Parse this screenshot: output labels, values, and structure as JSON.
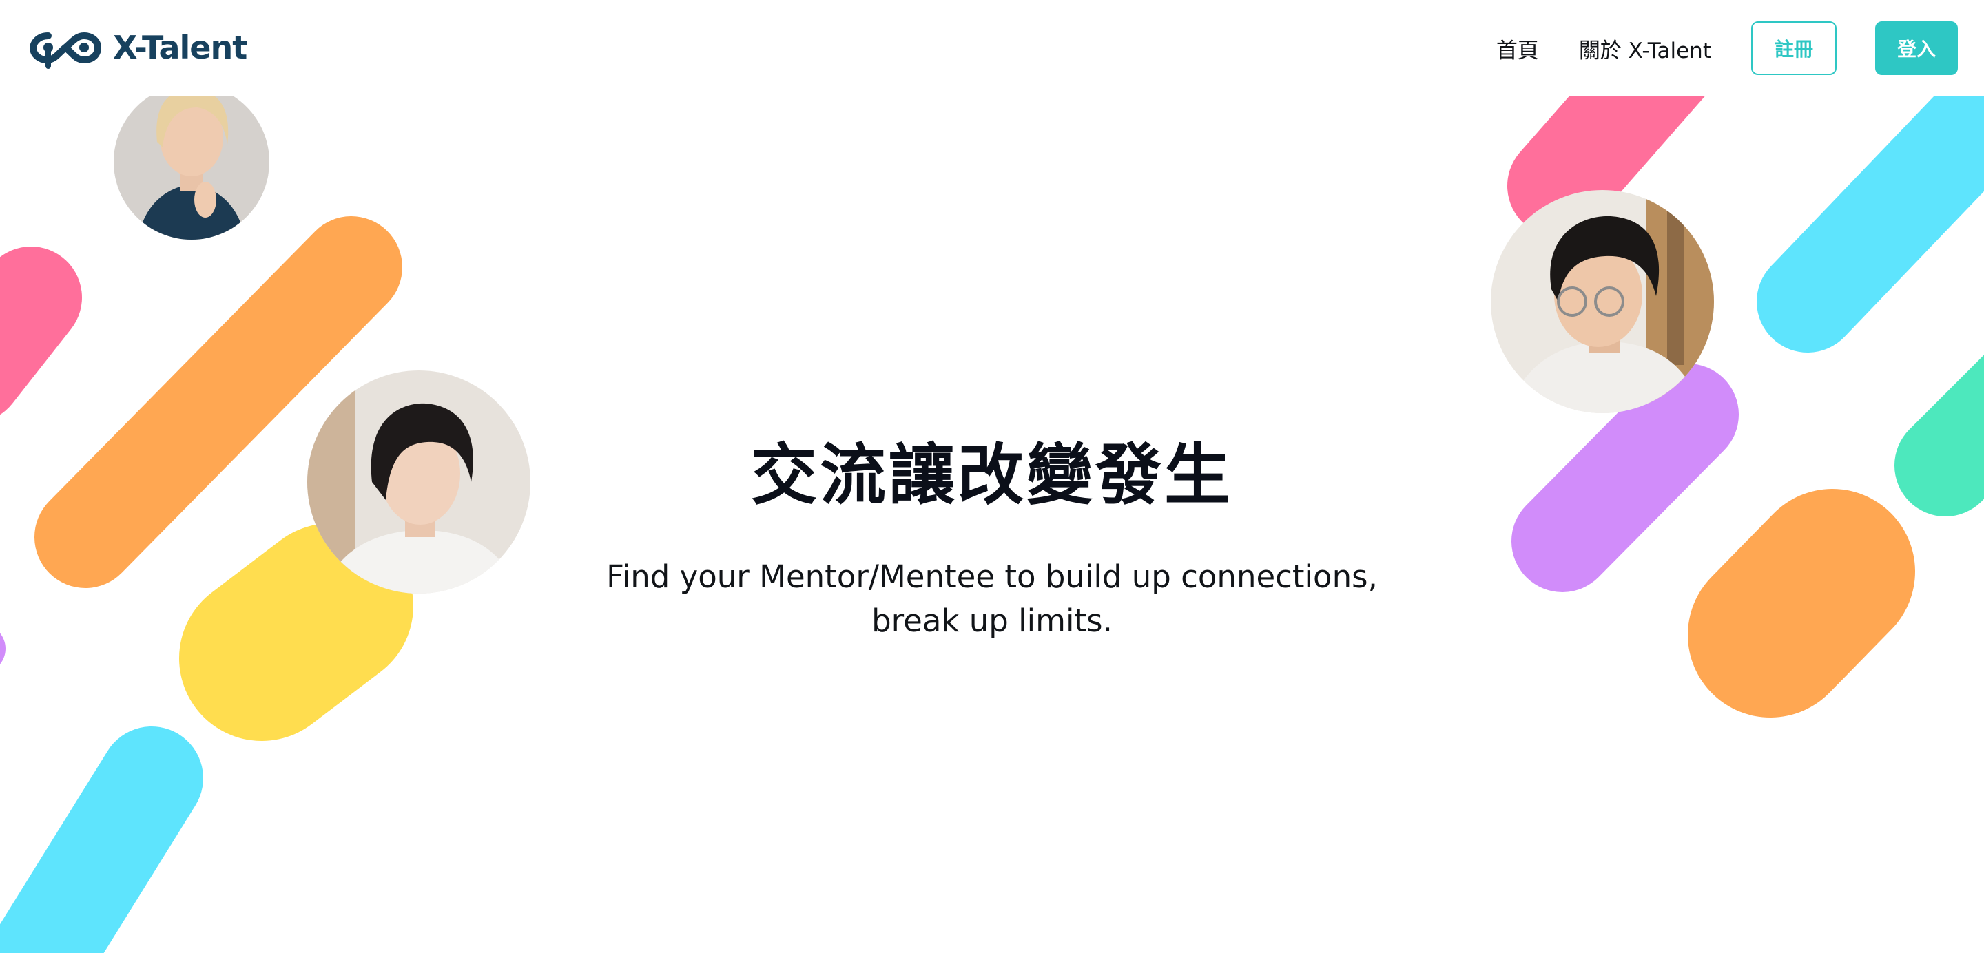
{
  "header": {
    "logo_text": "X-Talent",
    "nav": {
      "home_label": "首頁",
      "about_label": "關於 X-Talent"
    },
    "register_label": "註冊",
    "login_label": "登入"
  },
  "hero": {
    "title": "交流讓改變發生",
    "subtitle": "Find your Mentor/Mentee to build up connections, break up limits."
  },
  "colors": {
    "brand_dark": "#17415e",
    "accent_teal": "#2ec7c4",
    "pink": "#ff6f9b",
    "orange": "#ffa752",
    "yellow": "#ffdd4f",
    "cyan": "#5ee4fd",
    "purple": "#d18cfa",
    "green": "#4de8bd"
  },
  "decorations": {
    "portraits": [
      "woman-blonde-portrait",
      "woman-dark-hair-portrait",
      "man-glasses-portrait"
    ],
    "icons": [
      "logo-icon"
    ]
  }
}
